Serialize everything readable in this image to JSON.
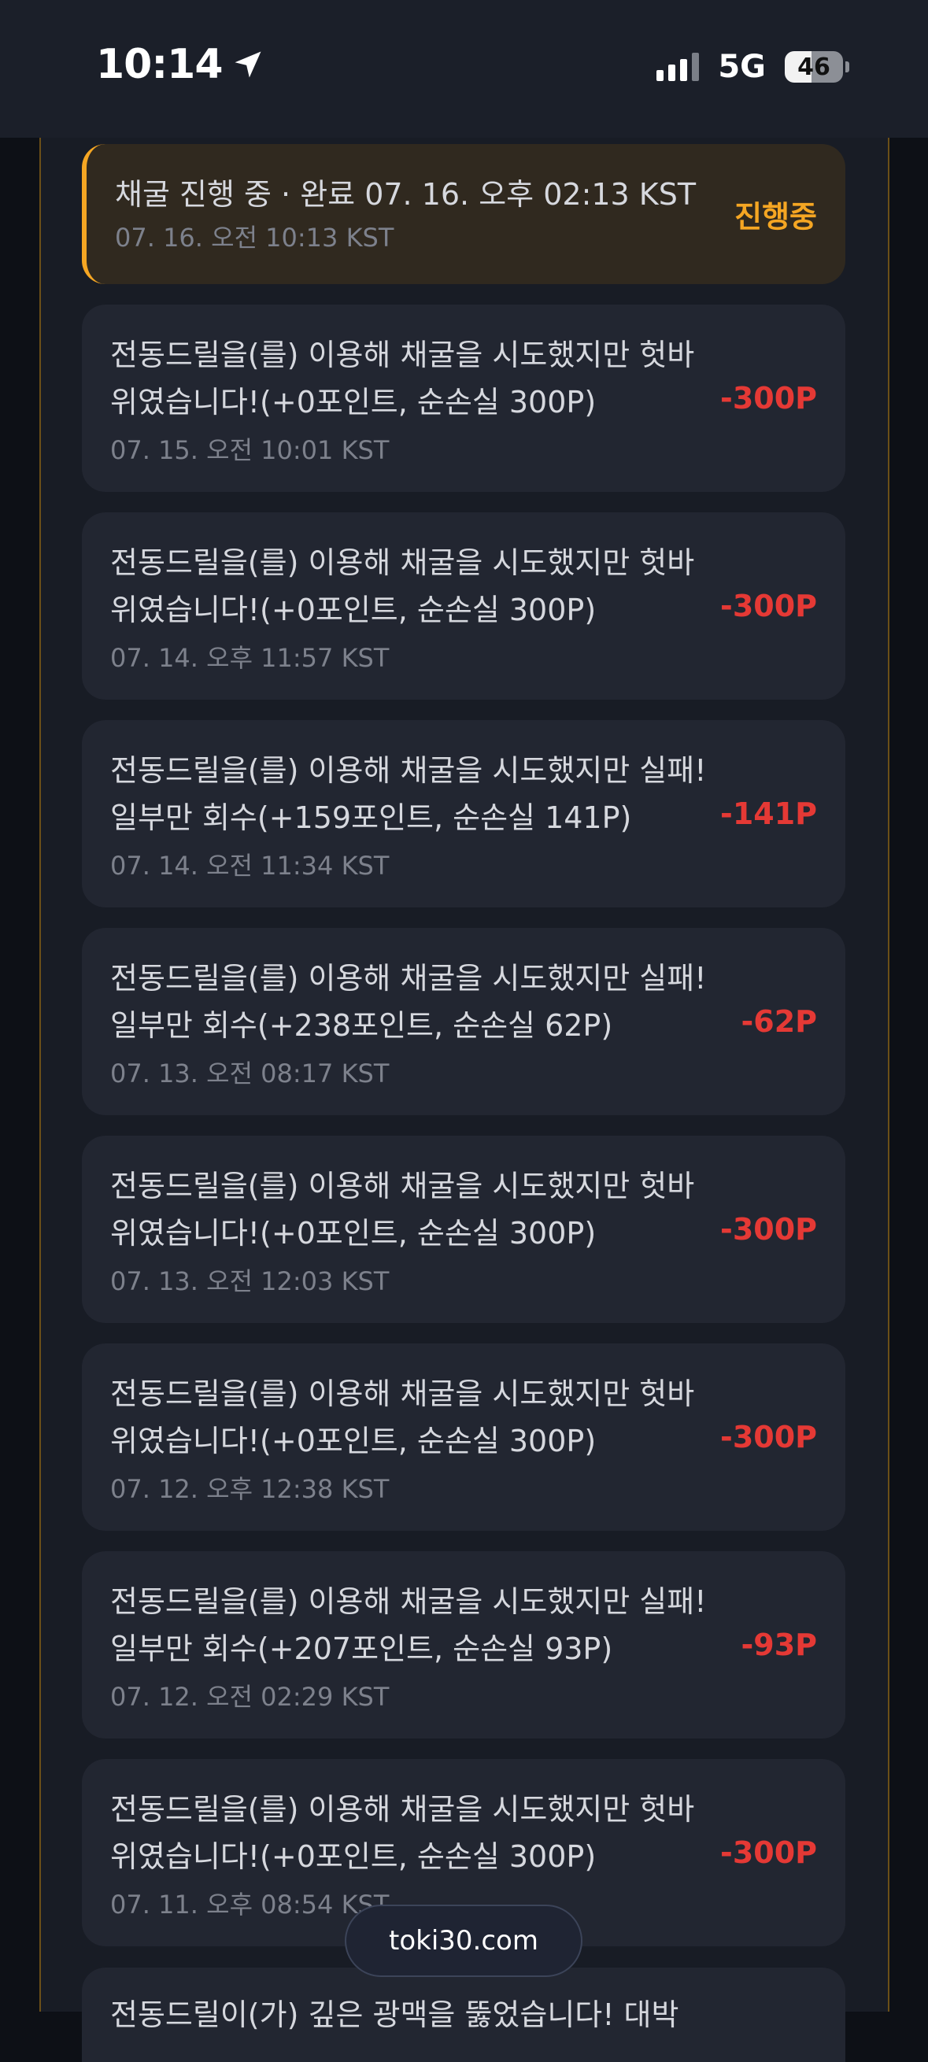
{
  "status_bar": {
    "time": "10:14",
    "network": "5G",
    "battery": "46"
  },
  "history": {
    "in_progress": {
      "text": "채굴 진행 중 · 완료 07. 16. 오후 02:13 KST",
      "date": "07. 16. 오전 10:13 KST",
      "status": "진행중"
    },
    "items": [
      {
        "text": "전동드릴을(를) 이용해 채굴을 시도했지만 헛바위였습니다!(+0포인트, 순손실 300P)",
        "date": "07. 15. 오전 10:01 KST",
        "amount": "-300P"
      },
      {
        "text": "전동드릴을(를) 이용해 채굴을 시도했지만 헛바위였습니다!(+0포인트, 순손실 300P)",
        "date": "07. 14. 오후 11:57 KST",
        "amount": "-300P"
      },
      {
        "text": "전동드릴을(를) 이용해 채굴을 시도했지만 실패! 일부만 회수(+159포인트, 순손실 141P)",
        "date": "07. 14. 오전 11:34 KST",
        "amount": "-141P"
      },
      {
        "text": "전동드릴을(를) 이용해 채굴을 시도했지만 실패! 일부만 회수(+238포인트, 순손실 62P)",
        "date": "07. 13. 오전 08:17 KST",
        "amount": "-62P"
      },
      {
        "text": "전동드릴을(를) 이용해 채굴을 시도했지만 헛바위였습니다!(+0포인트, 순손실 300P)",
        "date": "07. 13. 오전 12:03 KST",
        "amount": "-300P"
      },
      {
        "text": "전동드릴을(를) 이용해 채굴을 시도했지만 헛바위였습니다!(+0포인트, 순손실 300P)",
        "date": "07. 12. 오후 12:38 KST",
        "amount": "-300P"
      },
      {
        "text": "전동드릴을(를) 이용해 채굴을 시도했지만 실패! 일부만 회수(+207포인트, 순손실 93P)",
        "date": "07. 12. 오전 02:29 KST",
        "amount": "-93P"
      },
      {
        "text": "전동드릴을(를) 이용해 채굴을 시도했지만 헛바위였습니다!(+0포인트, 순손실 300P)",
        "date": "07. 11. 오후 08:54 KST",
        "amount": "-300P"
      }
    ],
    "partial_text": "전동드릴이(가) 깊은 광맥을 뚫었습니다! 대박"
  },
  "site_label": "toki30.com",
  "colors": {
    "accent": "#f5a623",
    "loss": "#e53935",
    "card_bg": "#222631",
    "panel_bg": "#181c25"
  }
}
